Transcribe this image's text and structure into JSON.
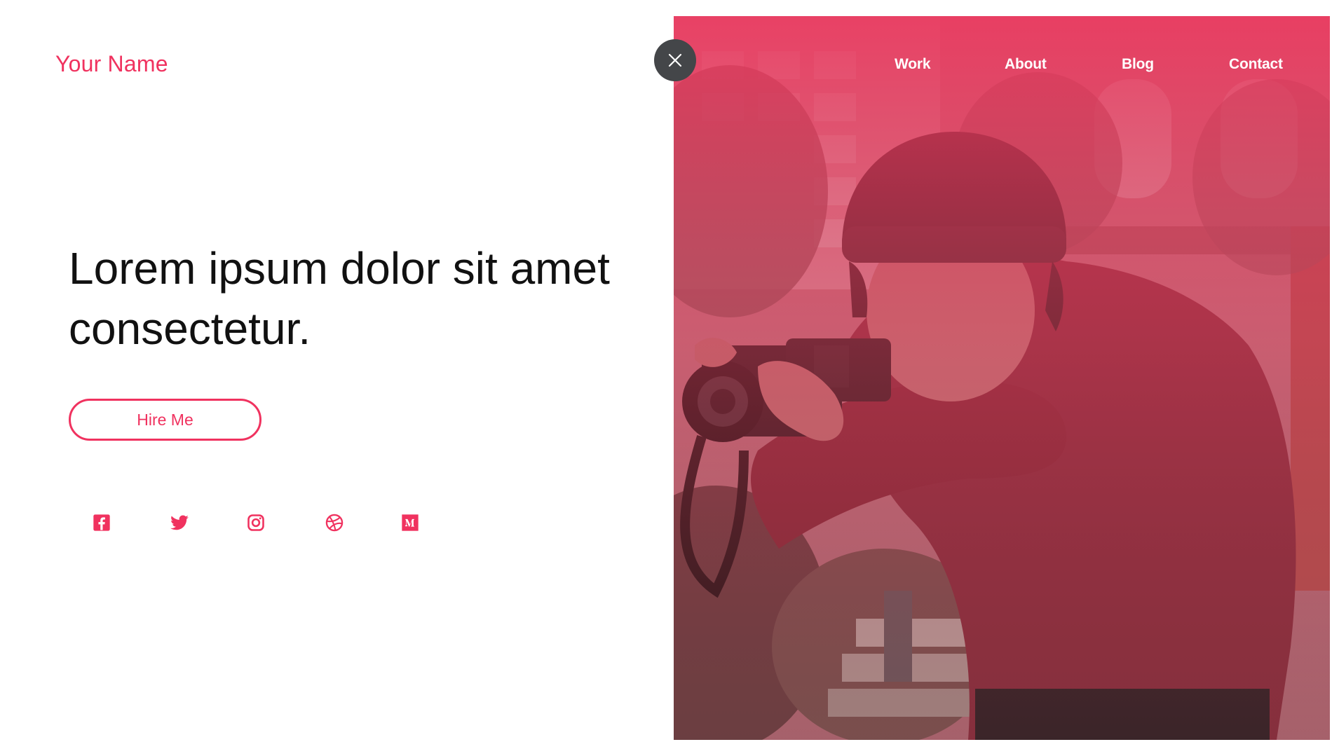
{
  "brand": {
    "name": "Your Name"
  },
  "nav": {
    "items": [
      {
        "label": "Work"
      },
      {
        "label": "About"
      },
      {
        "label": "Blog"
      },
      {
        "label": "Contact"
      }
    ]
  },
  "hero": {
    "headline": "Lorem ipsum dolor sit amet consectetur.",
    "cta_label": "Hire Me"
  },
  "social": {
    "icons": [
      "facebook-icon",
      "twitter-icon",
      "instagram-icon",
      "dribbble-icon",
      "medium-icon"
    ]
  },
  "colors": {
    "accent": "#f0325f",
    "close_button": "#444649",
    "text": "#111111",
    "overlay": "#e8365c"
  },
  "icons": {
    "close": "close-icon"
  }
}
